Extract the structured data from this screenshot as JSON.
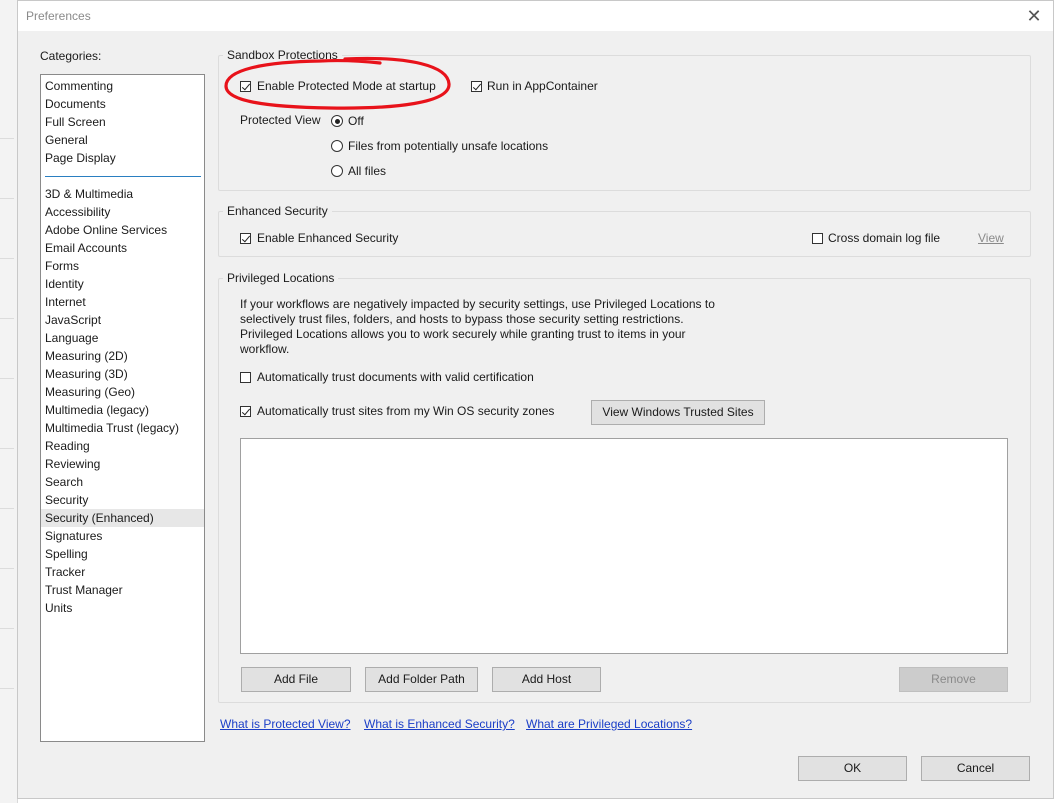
{
  "window": {
    "title": "Preferences",
    "close_glyph": "✕"
  },
  "categories": {
    "label": "Categories:",
    "group1": [
      "Commenting",
      "Documents",
      "Full Screen",
      "General",
      "Page Display"
    ],
    "group2": [
      "3D & Multimedia",
      "Accessibility",
      "Adobe Online Services",
      "Email Accounts",
      "Forms",
      "Identity",
      "Internet",
      "JavaScript",
      "Language",
      "Measuring (2D)",
      "Measuring (3D)",
      "Measuring (Geo)",
      "Multimedia (legacy)",
      "Multimedia Trust (legacy)",
      "Reading",
      "Reviewing",
      "Search",
      "Security",
      "Security (Enhanced)",
      "Signatures",
      "Spelling",
      "Tracker",
      "Trust Manager",
      "Units"
    ],
    "selected": "Security (Enhanced)"
  },
  "sandbox": {
    "legend": "Sandbox Protections",
    "protected_mode": {
      "label": "Enable Protected Mode at startup",
      "checked": true
    },
    "appcontainer": {
      "label": "Run in AppContainer",
      "checked": true
    },
    "protected_view_label": "Protected View",
    "options": [
      {
        "label": "Off",
        "checked": true
      },
      {
        "label": "Files from potentially unsafe locations",
        "checked": false
      },
      {
        "label": "All files",
        "checked": false
      }
    ]
  },
  "enhanced": {
    "legend": "Enhanced Security",
    "enable": {
      "label": "Enable Enhanced Security",
      "checked": true
    },
    "cross_domain": {
      "label": "Cross domain log file",
      "checked": false
    },
    "view_link": "View"
  },
  "privileged": {
    "legend": "Privileged Locations",
    "description": "If your workflows are negatively impacted by security settings, use Privileged Locations to selectively trust files, folders, and hosts to bypass those security setting restrictions. Privileged Locations allows you to work securely while granting trust to items in your workflow.",
    "trust_docs": {
      "label": "Automatically trust documents with valid certification",
      "checked": false
    },
    "trust_sites": {
      "label": "Automatically trust sites from my Win OS security zones",
      "checked": true
    },
    "view_sites_button": "View Windows Trusted Sites",
    "add_file": "Add File",
    "add_folder": "Add Folder Path",
    "add_host": "Add Host",
    "remove": "Remove"
  },
  "links": {
    "protected_view": "What is Protected View?",
    "enhanced_security": "What is Enhanced Security?",
    "privileged_locations": "What are Privileged Locations?"
  },
  "footer": {
    "ok": "OK",
    "cancel": "Cancel"
  },
  "colors": {
    "accent_line": "#2a7fc1",
    "annotation": "#e8121a",
    "link": "#1a3ec7"
  }
}
